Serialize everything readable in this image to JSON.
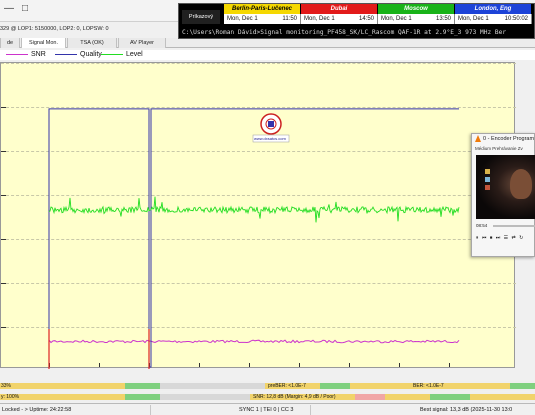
{
  "window": {
    "status_line": "329 @ LOP1: 5150000, LOP2: 0, LOPSW: 0",
    "controls": [
      "—",
      "□"
    ]
  },
  "tabs": [
    {
      "label": "de",
      "active": false
    },
    {
      "label": "Signal Mon.",
      "active": true
    },
    {
      "label": "TSA (OK)",
      "active": false
    },
    {
      "label": "AV Player",
      "active": false
    }
  ],
  "legend": [
    {
      "name": "SNR",
      "color": "#cc33cc"
    },
    {
      "name": "Quality",
      "color": "#3333aa"
    },
    {
      "name": "Level",
      "color": "#22dd22"
    }
  ],
  "chart_data": {
    "type": "line",
    "series": [
      {
        "name": "SNR",
        "color": "#cc33cc",
        "level": 0.91
      },
      {
        "name": "Quality",
        "color": "#3333aa",
        "level": 0.15
      },
      {
        "name": "Level",
        "color": "#22dd22",
        "level": 0.48
      }
    ],
    "grid": true
  },
  "logo": {
    "text": "www.dxsatcs.com"
  },
  "bottom_bars": {
    "row1": {
      "left": "33%",
      "mid": "preBER: <1.0E-7",
      "right": "BER: <1.0E-7"
    },
    "row2": {
      "left": "y: 100%",
      "mid": "SNR: 12,8 dB (Margin: 4,9 dB / Poor)"
    }
  },
  "statusbar": {
    "locked": "Locked - > Uptime: 24:22:58",
    "sync": "SYNC 1 | TEI 0 | CC 3",
    "best": "Best signal: 13,3 dB (2025-11-30 13:0"
  },
  "world_clock": {
    "prikazovy": "Príkazový",
    "cities": [
      {
        "name": "Berlin-Paris-Lučenec",
        "color": "#f5d800",
        "text": "#000000",
        "day": "Mon, Dec 1",
        "time": "11:50"
      },
      {
        "name": "Dubai",
        "color": "#e21a1a",
        "text": "#ffffff",
        "day": "Mon, Dec 1",
        "time": "14:50"
      },
      {
        "name": "Moscow",
        "color": "#19b319",
        "text": "#ffffff",
        "day": "Mon, Dec 1",
        "time": "13:50"
      },
      {
        "name": "London, Eng",
        "color": "#1c43d8",
        "text": "#ffffff",
        "day": "Mon, Dec 1",
        "time": "10:50:02"
      }
    ],
    "command": "C:\\Users\\Roman Dávid>Signal monitoring_PF458_SK/LC_Rascom QAF-1R at 2.9°E_3 973 MHz Ber"
  },
  "encoder": {
    "title": "0 - Encoder Program",
    "menu": "Médium  Prehrávanie  Zv",
    "time": "08:54",
    "controls": [
      "⏸",
      "⏮",
      "⏹",
      "⏭",
      "☰",
      "⇄",
      "↻"
    ]
  }
}
